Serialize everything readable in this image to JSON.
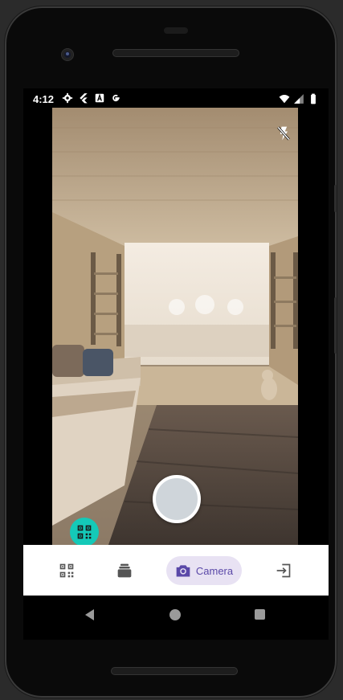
{
  "status_bar": {
    "time": "4:12",
    "left_icons": [
      "settings-icon",
      "flutter-icon",
      "a-icon",
      "google-icon"
    ],
    "right_icons": [
      "wifi-icon",
      "signal-icon",
      "battery-icon"
    ]
  },
  "camera": {
    "flash_icon": "flash-off-icon",
    "shutter_icon": "shutter-button",
    "qr_fab_icon": "qr-code-icon",
    "accent_color": "#14c9b8"
  },
  "bottom_nav": {
    "items": [
      {
        "icon": "qr-code-icon",
        "label": ""
      },
      {
        "icon": "layers-icon",
        "label": ""
      },
      {
        "icon": "camera-icon",
        "label": "Camera",
        "selected": true
      },
      {
        "icon": "exit-icon",
        "label": ""
      }
    ],
    "selected_color": "#5a48a8",
    "selected_bg": "#e8e2f3"
  },
  "system_nav": {
    "icons": [
      "back-icon",
      "home-icon",
      "recents-icon"
    ]
  }
}
